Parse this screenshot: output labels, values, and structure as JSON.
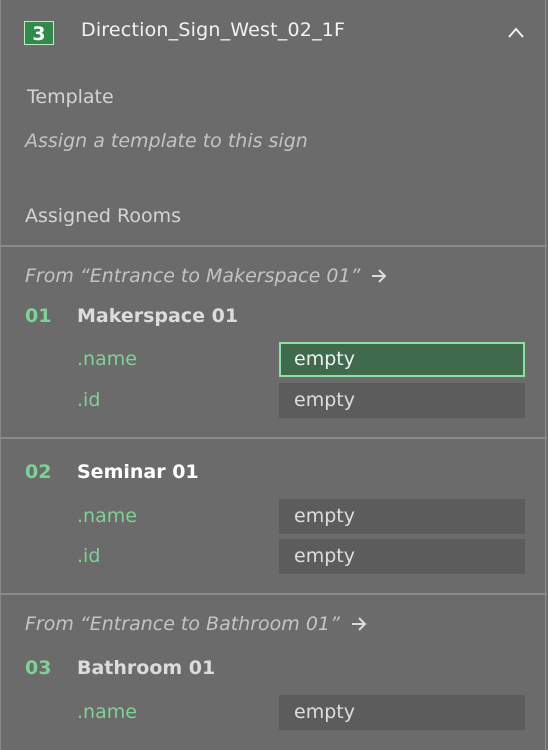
{
  "header": {
    "badge": "3",
    "title": "Direction_Sign_West_02_1F",
    "collapse_icon": "chevron-up-icon"
  },
  "template": {
    "label": "Template",
    "placeholder": "Assign a template to this sign"
  },
  "assigned_rooms": {
    "label": "Assigned Rooms",
    "groups": [
      {
        "from_label": "From “Entrance to Makerspace 01”",
        "rooms": [
          {
            "number": "01",
            "name": "Makerspace 01",
            "fields": [
              {
                "key": ".name",
                "value": "empty",
                "active": true
              },
              {
                "key": ".id",
                "value": "empty"
              }
            ]
          },
          {
            "number": "02",
            "name": "Seminar 01",
            "fields": [
              {
                "key": ".name",
                "value": "empty"
              },
              {
                "key": ".id",
                "value": "empty"
              }
            ]
          }
        ]
      },
      {
        "from_label": "From “Entrance to Bathroom 01”",
        "rooms": [
          {
            "number": "03",
            "name": "Bathroom 01",
            "fields": [
              {
                "key": ".name",
                "value": "empty"
              }
            ]
          }
        ]
      }
    ]
  },
  "colors": {
    "background": "#6b6b6b",
    "accent_green": "#7fd196",
    "badge_green": "#2f8a4c",
    "active_field": "#3f6a4d"
  }
}
